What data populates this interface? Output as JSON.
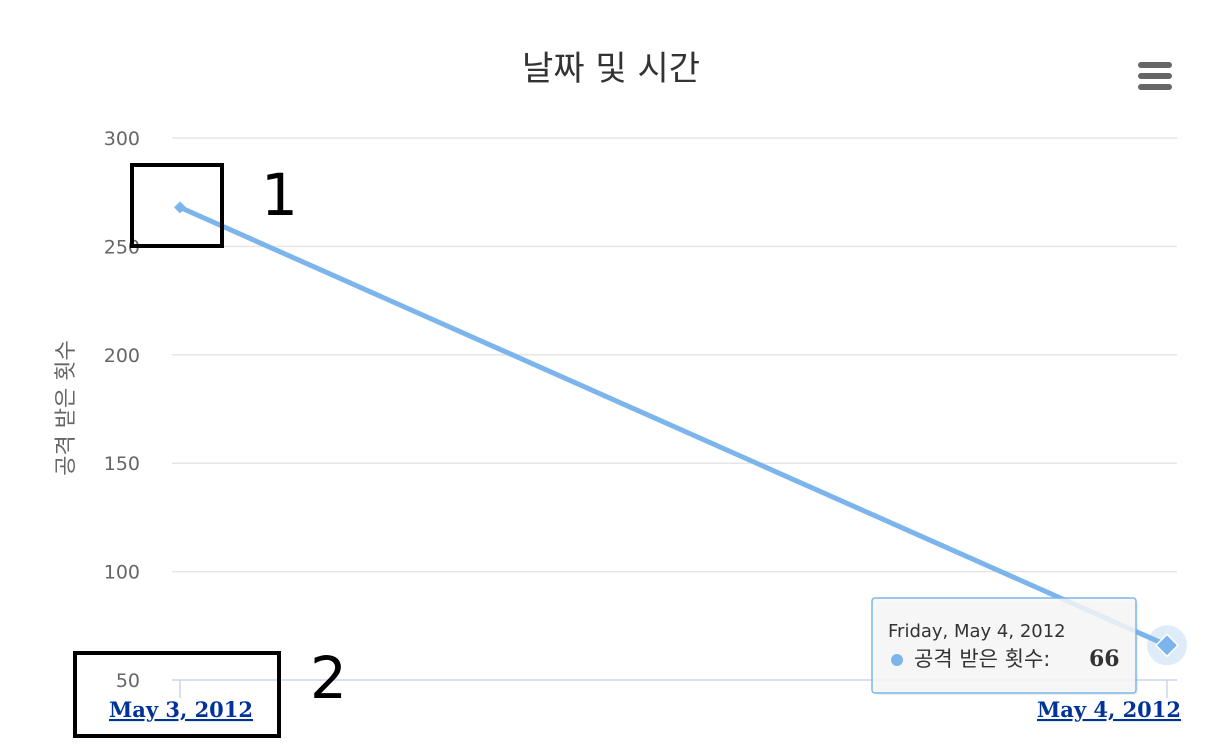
{
  "chart_data": {
    "type": "line",
    "title": "날짜 및 시간",
    "xlabel": "",
    "ylabel": "공격 받은 횟수",
    "categories": [
      "May 3, 2012",
      "May 4, 2012"
    ],
    "series": [
      {
        "name": "공격 받은 횟수",
        "values": [
          268,
          66
        ],
        "color": "#7cb5ec"
      }
    ],
    "ylim": [
      50,
      300
    ],
    "yticks": [
      50,
      100,
      150,
      200,
      250,
      300
    ],
    "grid": true,
    "legend": "none"
  },
  "tooltip": {
    "header": "Friday, May 4, 2012",
    "series_label": "공격 받은 횟수:",
    "value": "66"
  },
  "annotations": {
    "box1_label": "1",
    "box2_label": "2"
  },
  "menu": {
    "icon": "hamburger-menu-icon"
  },
  "colors": {
    "series": "#7cb5ec",
    "grid": "#e6e6e6",
    "axis": "#ccd6eb",
    "link": "#003399"
  }
}
